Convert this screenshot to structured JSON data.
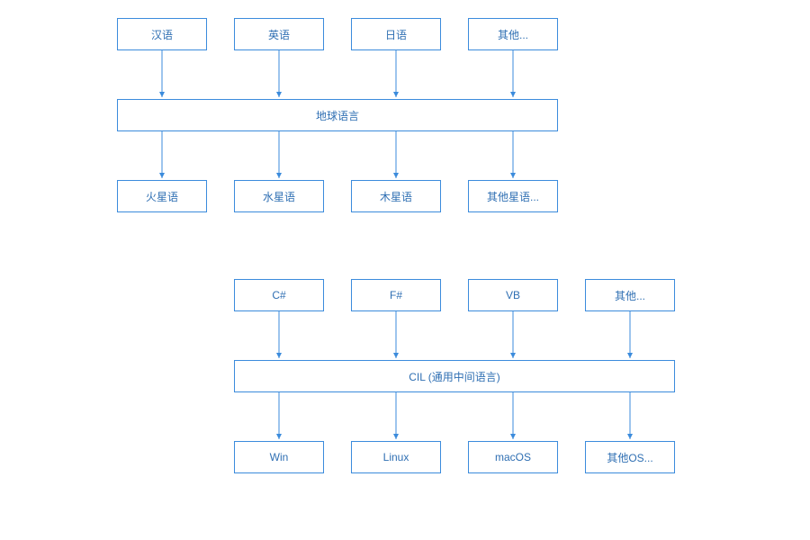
{
  "diagram1": {
    "top_row": [
      "汉语",
      "英语",
      "日语",
      "其他..."
    ],
    "middle": "地球语言",
    "bottom_row": [
      "火星语",
      "水星语",
      "木星语",
      "其他星语..."
    ]
  },
  "diagram2": {
    "top_row": [
      "C#",
      "F#",
      "VB",
      "其他..."
    ],
    "middle": "CIL (通用中间语言)",
    "bottom_row": [
      "Win",
      "Linux",
      "macOS",
      "其他OS..."
    ]
  },
  "colors": {
    "border": "#3b8bdc",
    "text": "#2f6fb3"
  }
}
